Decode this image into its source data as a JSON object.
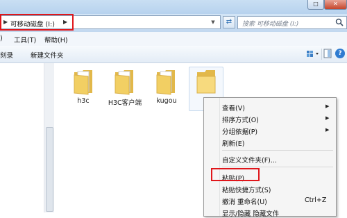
{
  "address": {
    "breadcrumb": "可移动磁盘 (I:)",
    "search_placeholder": "搜索 可移动磁盘 (I:)"
  },
  "menubar": {
    "partial_left": ")",
    "items": [
      "工具(T)",
      "帮助(H)"
    ]
  },
  "toolbar": {
    "partial_left": "刻录",
    "new_folder": "新建文件夹",
    "help": "?"
  },
  "folders": [
    {
      "label": "h3c"
    },
    {
      "label": "H3C客户端"
    },
    {
      "label": "kugou"
    },
    {
      "label": ""
    }
  ],
  "context_menu": {
    "items": [
      {
        "label": "查看(V)",
        "submenu": true
      },
      {
        "label": "排序方式(O)",
        "submenu": true
      },
      {
        "label": "分组依据(P)",
        "submenu": true
      },
      {
        "label": "刷新(E)"
      },
      {
        "label": "自定义文件夹(F)..."
      },
      {
        "label": "粘贴(P)"
      },
      {
        "label": "粘贴快捷方式(S)"
      },
      {
        "label": "撤消 重命名(U)",
        "shortcut": "Ctrl+Z"
      },
      {
        "label": "显示/隐藏 隐藏文件"
      }
    ]
  },
  "colors": {
    "highlight_red": "#e0161b",
    "folder_yellow": "#f2cf63"
  }
}
